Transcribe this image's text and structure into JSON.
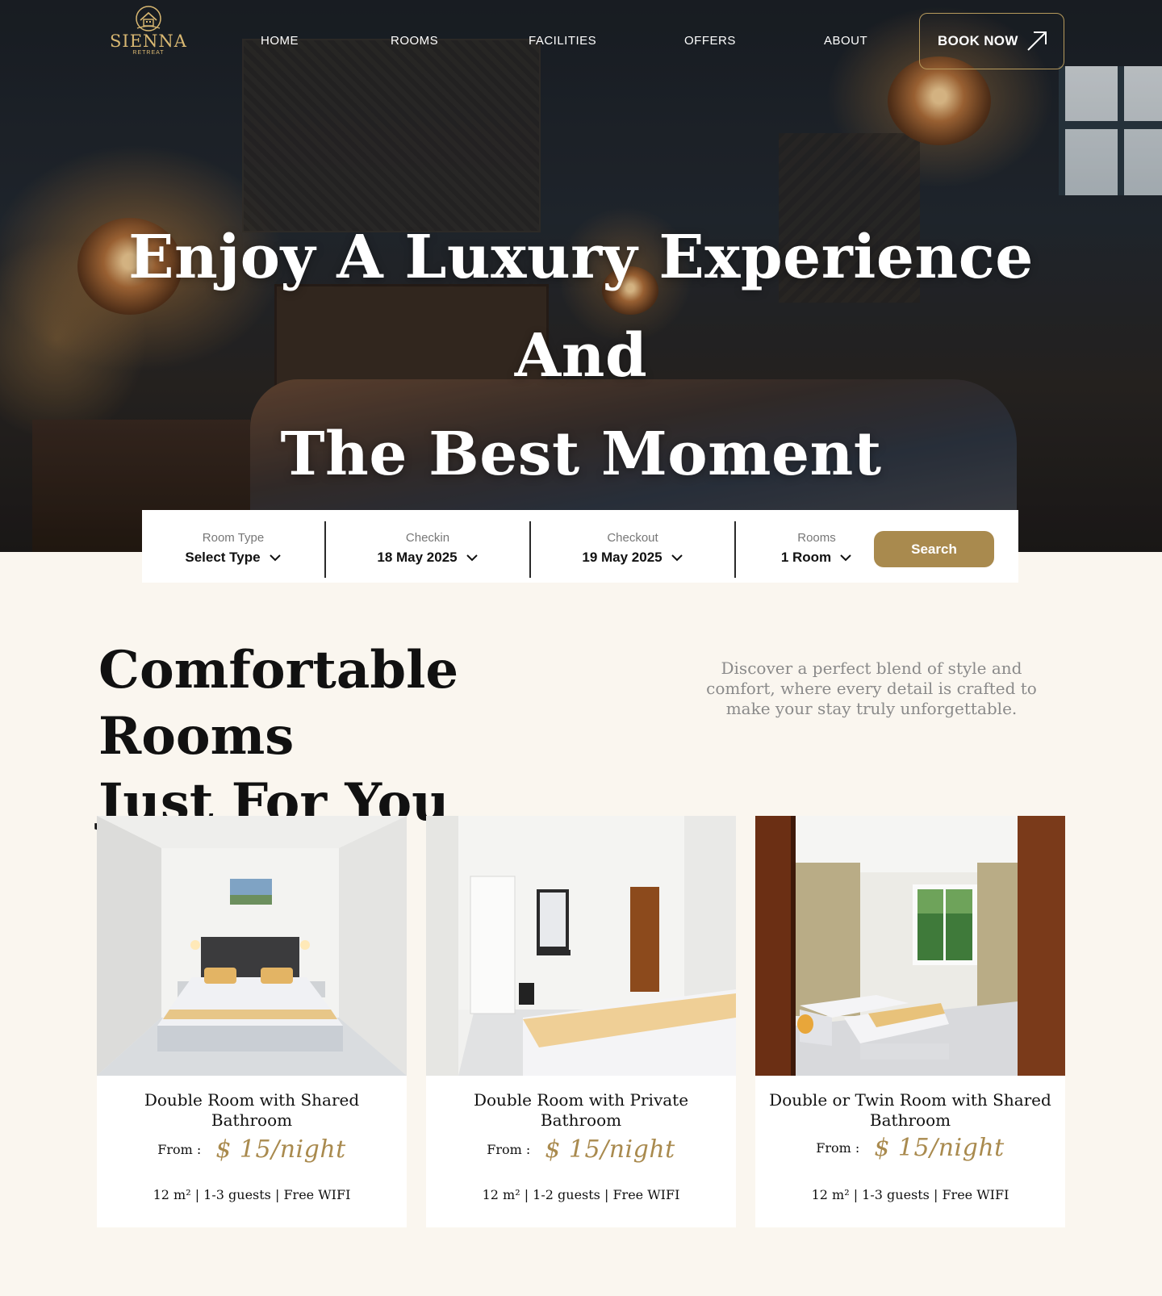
{
  "brand": {
    "name": "SIENNA",
    "tagline": "RETREAT",
    "accent": "#a98a4e",
    "logo_color": "#d9b872"
  },
  "nav": {
    "items": [
      "HOME",
      "ROOMS",
      "FACILITIES",
      "OFFERS",
      "ABOUT"
    ],
    "cta_label": "BOOK NOW"
  },
  "hero": {
    "title_line1": "Enjoy A Luxury Experience And",
    "title_line2": "The Best Moment"
  },
  "search": {
    "room_type": {
      "label": "Room Type",
      "value": "Select Type"
    },
    "checkin": {
      "label": "Checkin",
      "value": "18 May 2025"
    },
    "checkout": {
      "label": "Checkout",
      "value": "19 May 2025"
    },
    "rooms": {
      "label": "Rooms",
      "value": "1 Room"
    },
    "button_label": "Search"
  },
  "rooms_section": {
    "title_line1": "Comfortable Rooms",
    "title_line2": "Just For You",
    "description": "Discover a perfect blend of style and comfort, where every detail is crafted to make your stay truly unforgettable.",
    "cards": [
      {
        "title": "Double Room with Shared Bathroom",
        "from_label": "From :",
        "price": "$ 15/night",
        "meta": "12 m² | 1-3 guests | Free WIFI"
      },
      {
        "title": "Double Room with Private Bathroom",
        "from_label": "From :",
        "price": "$ 15/night",
        "meta": "12 m² | 1-2 guests | Free WIFI"
      },
      {
        "title": "Double or Twin Room with Shared Bathroom",
        "from_label": "From :",
        "price": "$ 15/night",
        "meta": "12 m² | 1-3 guests | Free WIFI"
      }
    ]
  }
}
